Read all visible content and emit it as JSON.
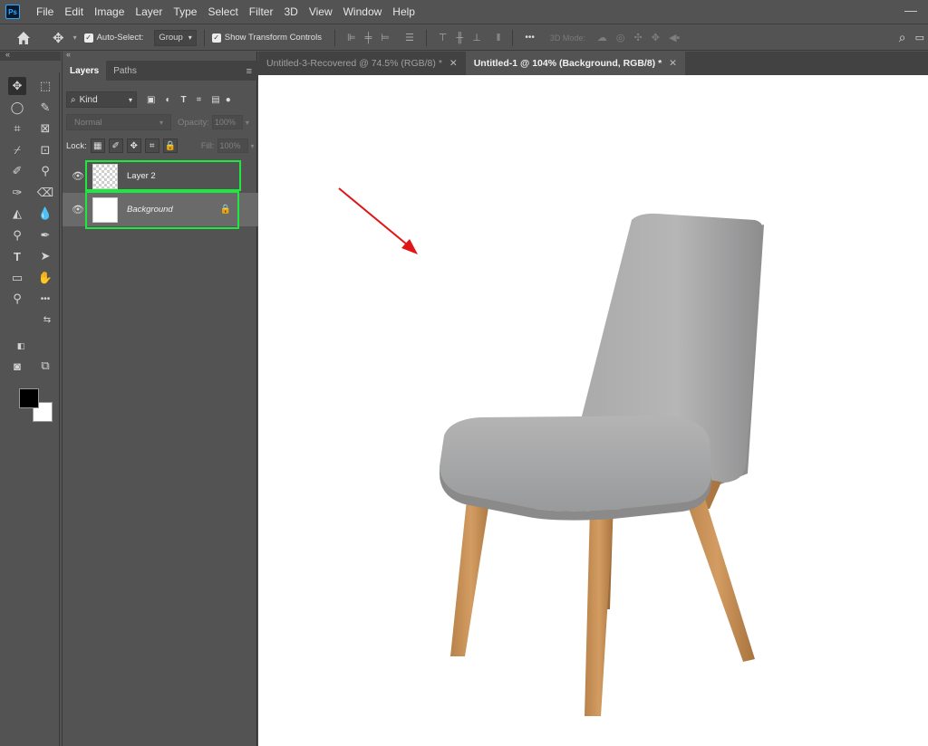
{
  "app": {
    "logo": "Ps"
  },
  "menu": [
    "File",
    "Edit",
    "Image",
    "Layer",
    "Type",
    "Select",
    "Filter",
    "3D",
    "View",
    "Window",
    "Help"
  ],
  "options": {
    "auto_select_label": "Auto-Select:",
    "group_value": "Group",
    "show_transform_label": "Show Transform Controls",
    "three_d_mode": "3D Mode:",
    "more_glyph": "•••"
  },
  "layers_panel": {
    "tabs": [
      "Layers",
      "Paths"
    ],
    "kind_label": "Kind",
    "blend_mode": "Normal",
    "opacity_label": "Opacity:",
    "opacity_value": "100%",
    "lock_label": "Lock:",
    "fill_label": "Fill:",
    "fill_value": "100%",
    "layers": [
      {
        "name": "Layer 2",
        "visible": true,
        "thumbnail": "transparent-checker"
      },
      {
        "name": "Background",
        "visible": true,
        "thumbnail": "white",
        "locked": true,
        "selected": true
      }
    ]
  },
  "documents": {
    "tabs": [
      {
        "label": "Untitled-3-Recovered @ 74.5% (RGB/8) *",
        "active": false
      },
      {
        "label": "Untitled-1 @ 104% (Background, RGB/8) *",
        "active": true
      }
    ]
  },
  "colors": {
    "foreground": "#000000",
    "background": "#ffffff",
    "highlight": "#1ee83e",
    "arrow": "#e01616"
  }
}
